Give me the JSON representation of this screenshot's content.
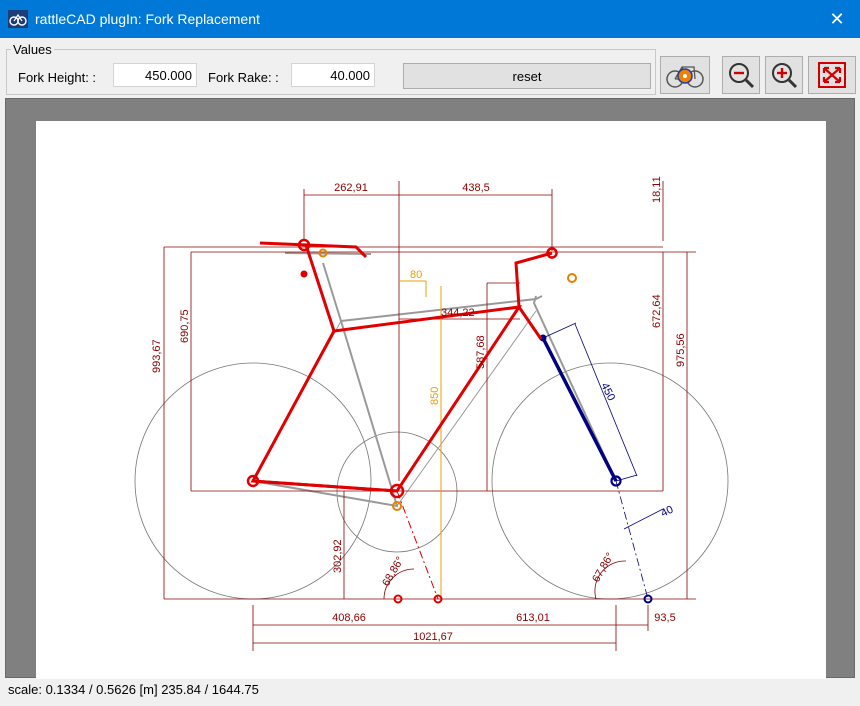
{
  "window": {
    "title": "rattleCAD plugIn: Fork Replacement",
    "close_glyph": "✕"
  },
  "values_group": {
    "legend": "Values",
    "fork_height": {
      "label": "Fork Height: :",
      "value": "450.000"
    },
    "fork_rake": {
      "label": "Fork Rake: :",
      "value": "40.000"
    },
    "reset_label": "reset"
  },
  "toolbar": {
    "icons": [
      "render-bike-icon",
      "zoom-out-icon",
      "zoom-in-icon",
      "fit-screen-icon"
    ]
  },
  "drawing": {
    "dims": {
      "d262": "262,91",
      "d438": "438,5",
      "d18": "18,11",
      "d80": "80",
      "d344": "344,22",
      "d690": "690,75",
      "d993": "993,67",
      "d587": "587,68",
      "d672": "672,64",
      "d975": "975,56",
      "d850": "850",
      "d450": "450",
      "d40": "40",
      "d302": "302,92",
      "a68": "68,86°",
      "a67": "67,86°",
      "d408": "408,66",
      "d613": "613,01",
      "d93": "93,5",
      "d1021": "1021,67"
    }
  },
  "status": {
    "text": "scale: 0.1334 / 0.5626  [m]  235.84 / 1644.75"
  }
}
